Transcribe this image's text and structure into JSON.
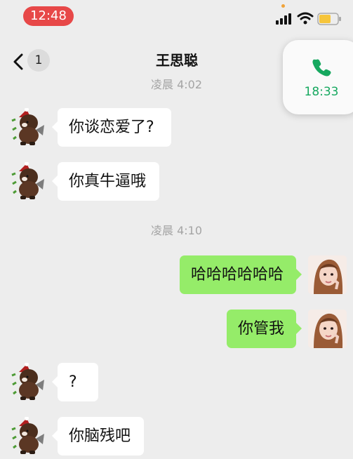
{
  "status_bar": {
    "time": "12:48"
  },
  "header": {
    "title": "王思聪",
    "unread_count": "1"
  },
  "call": {
    "time": "18:33",
    "icon": "phone-icon",
    "color": "#16a85f"
  },
  "timestamps": [
    "凌晨 4:02",
    "凌晨 4:10"
  ],
  "messages": [
    {
      "side": "left",
      "text": "你谈恋爱了?"
    },
    {
      "side": "left",
      "text": "你真牛逼哦"
    },
    {
      "side": "right",
      "text": "哈哈哈哈哈哈"
    },
    {
      "side": "right",
      "text": "你管我"
    },
    {
      "side": "left",
      "text": "?"
    },
    {
      "side": "left",
      "text": "你脑残吧"
    }
  ],
  "colors": {
    "background": "#ededed",
    "bubble_right": "#95ec69",
    "bubble_left": "#ffffff",
    "time_pill": "#e74848"
  }
}
